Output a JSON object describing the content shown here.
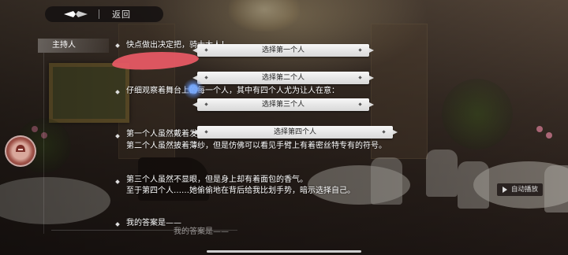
{
  "topbar": {
    "back_label": "返回"
  },
  "speaker": {
    "name": "主持人"
  },
  "dialogue": {
    "line1": "快点做出决定把，骑士大人！",
    "line2": "仔细观察着舞台上的每一个人，其中有四个人尤为让人在意：",
    "line3a": "第一个人虽然戴着发套，但是隐约间能够见到金色的头发。",
    "line3b": "第二个人虽然披着薄纱，但是仿佛可以看见手臂上有着密丝特专有的符号。",
    "line4a": "第三个人虽然不显眼，但是身上却有着面包的香气。",
    "line4b": "至于第四个人……她偷偷地在背后给我比划手势，暗示选择自己。",
    "line5": "我的答案是——",
    "answer_ghost": "我的答案是——"
  },
  "choices": [
    {
      "label": "选择第一个人"
    },
    {
      "label": "选择第二个人"
    },
    {
      "label": "选择第三个人"
    },
    {
      "label": "选择第四个人"
    }
  ],
  "autoplay": {
    "label": "自动播放"
  },
  "colors": {
    "redaction": "#ea5a66",
    "choice_bg": "#f0f0f0",
    "text": "#ffffff"
  },
  "icons": {
    "logo": "diamond-logo-icon",
    "play": "play-icon",
    "float": "helmet-icon"
  }
}
